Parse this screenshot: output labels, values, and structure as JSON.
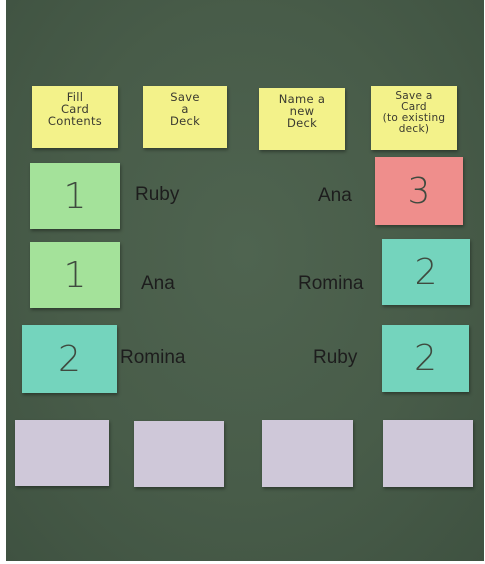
{
  "headers": [
    {
      "text": "Fill\nCard\nContents"
    },
    {
      "text": "Save\na\nDeck"
    },
    {
      "text": "Name a\nnew\nDeck"
    },
    {
      "text": "Save a\nCard\n(to existing\ndeck)"
    }
  ],
  "rows": [
    {
      "left_number": "1",
      "left_name": "Ruby",
      "right_name": "Ana",
      "right_number": "3"
    },
    {
      "left_number": "1",
      "left_name": "Ana",
      "right_name": "Romina",
      "right_number": "2"
    },
    {
      "left_number": "2",
      "left_name": "Romina",
      "right_name": "Ruby",
      "right_number": "2"
    }
  ],
  "colors": {
    "board": "#4b5f4c",
    "header_note": "#f3f28a",
    "green_note": "#a4e29a",
    "teal_note": "#74d4bd",
    "pink_note": "#ef8e8c",
    "blank_note": "#cfc8d9"
  }
}
